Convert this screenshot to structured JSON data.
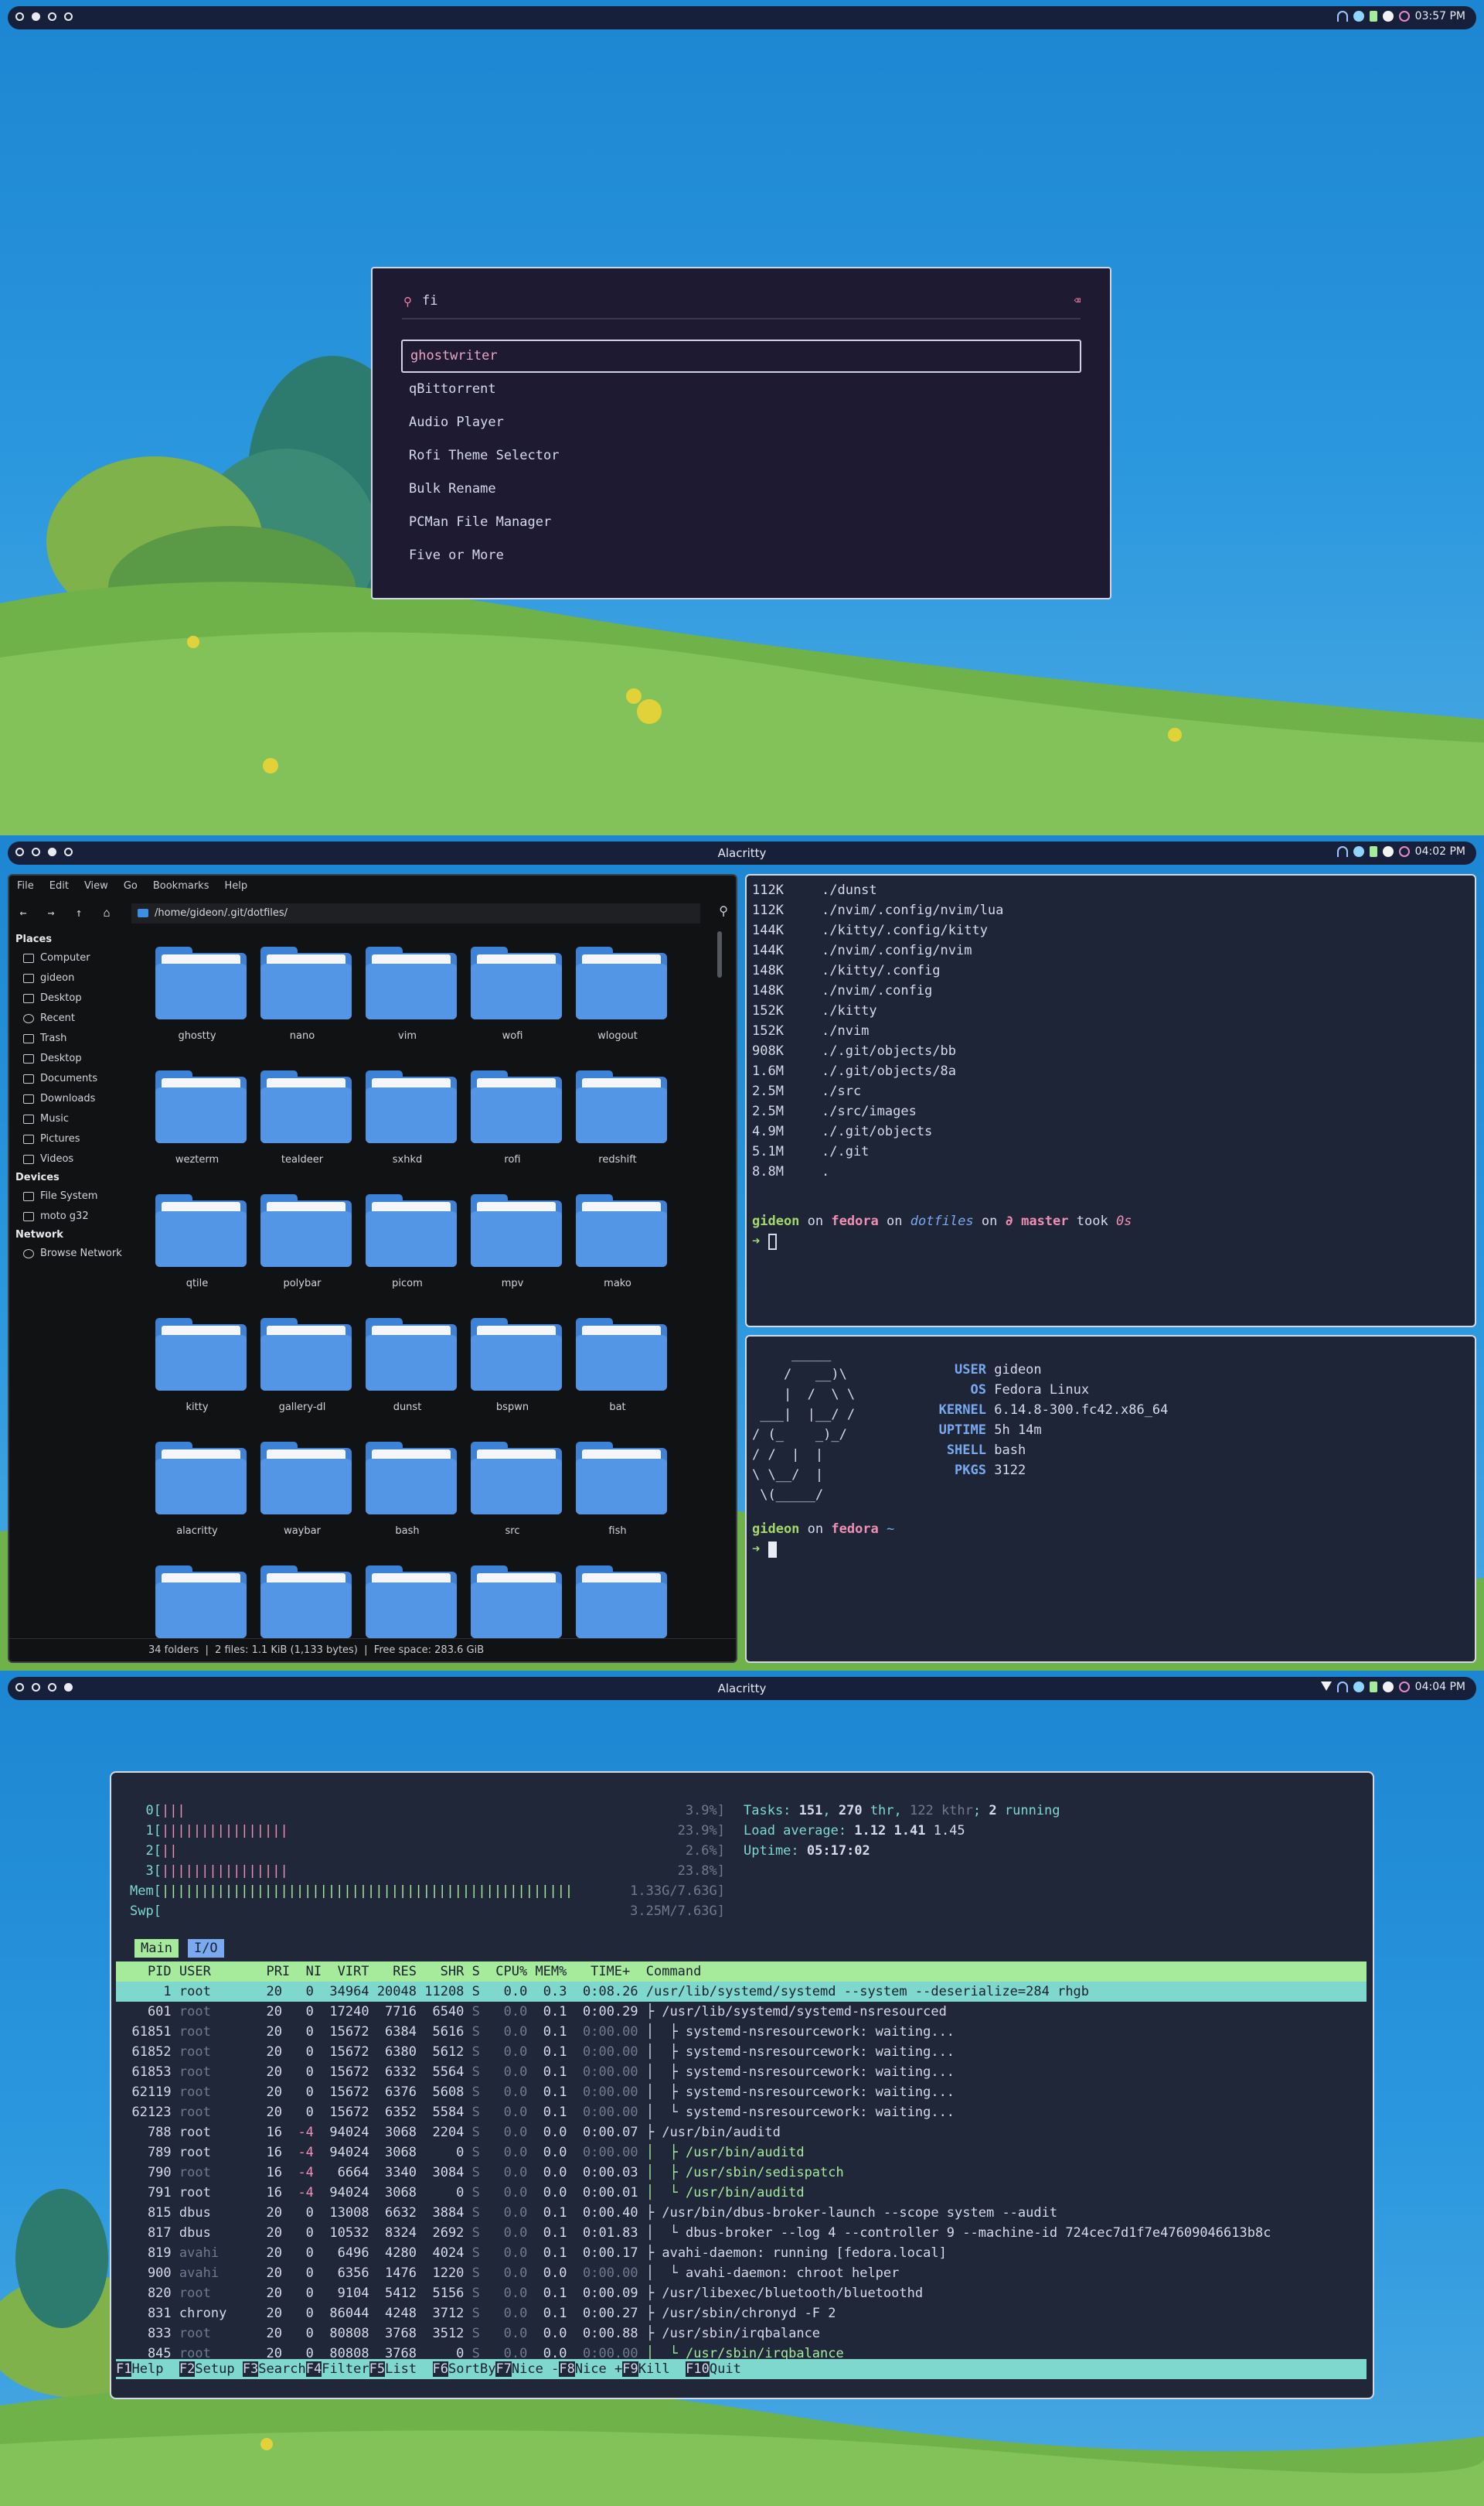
{
  "screen1": {
    "workspaces": [
      false,
      true,
      false,
      false
    ],
    "clock": "03:57 PM",
    "rofi": {
      "query": "fi",
      "items": [
        "ghostwriter",
        "qBittorrent",
        "Audio Player",
        "Rofi Theme Selector",
        "Bulk Rename",
        "PCMan File Manager",
        "Five or More"
      ],
      "selected": 0
    }
  },
  "screen2": {
    "title": "Alacritty",
    "clock": "04:02 PM",
    "filemanager": {
      "menu": [
        "File",
        "Edit",
        "View",
        "Go",
        "Bookmarks",
        "Help"
      ],
      "path": "/home/gideon/.git/dotfiles/",
      "places_header": "Places",
      "places": [
        "Computer",
        "gideon",
        "Desktop",
        "Recent",
        "Trash",
        "Desktop",
        "Documents",
        "Downloads",
        "Music",
        "Pictures",
        "Videos"
      ],
      "devices_header": "Devices",
      "devices": [
        "File System",
        "moto g32"
      ],
      "network_header": "Network",
      "network": [
        "Browse Network"
      ],
      "folders": [
        "ghostty",
        "nano",
        "vim",
        "wofi",
        "wlogout",
        "wezterm",
        "tealdeer",
        "sxhkd",
        "rofi",
        "redshift",
        "qtile",
        "polybar",
        "picom",
        "mpv",
        "mako",
        "kitty",
        "gallery-dl",
        "dunst",
        "bspwn",
        "bat",
        "alacritty",
        "waybar",
        "bash",
        "src",
        "fish",
        "",
        "",
        "",
        "",
        ""
      ],
      "status": "34 folders  |  2 files: 1.1 KiB (1,133 bytes)  |  Free space: 283.6 GiB"
    },
    "du": [
      [
        "112K",
        "./dunst"
      ],
      [
        "112K",
        "./nvim/.config/nvim/lua"
      ],
      [
        "144K",
        "./kitty/.config/kitty"
      ],
      [
        "144K",
        "./nvim/.config/nvim"
      ],
      [
        "148K",
        "./kitty/.config"
      ],
      [
        "148K",
        "./nvim/.config"
      ],
      [
        "152K",
        "./kitty"
      ],
      [
        "152K",
        "./nvim"
      ],
      [
        "908K",
        "./.git/objects/bb"
      ],
      [
        "1.6M",
        "./.git/objects/8a"
      ],
      [
        "2.5M",
        "./src"
      ],
      [
        "2.5M",
        "./src/images"
      ],
      [
        "4.9M",
        "./.git/objects"
      ],
      [
        "5.1M",
        "./.git"
      ],
      [
        "8.8M",
        "."
      ]
    ],
    "prompt1": {
      "user": "gideon",
      "on1": " on ",
      "host": "fedora",
      "dir": "dotfiles",
      "on2": " on ",
      "branch_icon": "∂",
      "branch": "master",
      "took": " took ",
      "time": "0s"
    },
    "arrow": "➜",
    "fetch": {
      "art": [
        "     _____",
        "    /   __)\\",
        "    |  /  \\ \\",
        " ___|  |__/ /",
        "/ (_    _)_/",
        "/ /  |  |",
        "\\ \\__/  |",
        " \\(_____/"
      ],
      "labels": [
        "USER",
        "OS",
        "KERNEL",
        "UPTIME",
        "SHELL",
        "PKGS"
      ],
      "values": [
        "gideon",
        "Fedora Linux",
        "6.14.8-300.fc42.x86_64",
        "5h 14m",
        "bash",
        "3122"
      ]
    },
    "prompt2": {
      "user": "gideon",
      "on": " on ",
      "host": "fedora",
      "dir": "~"
    }
  },
  "screen3": {
    "title": "Alacritty",
    "clock": "04:04 PM",
    "cpu": [
      {
        "label": "0",
        "bars": "|||",
        "value": "3.9%"
      },
      {
        "label": "1",
        "bars": "||||||||||||||||",
        "value": "23.9%"
      },
      {
        "label": "2",
        "bars": "||",
        "value": "2.6%"
      },
      {
        "label": "3",
        "bars": "||||||||||||||||",
        "value": "23.8%"
      }
    ],
    "mem": {
      "label": "Mem",
      "bars": "||||||||||||||||||||||||||||||||||||||||||||||||||||",
      "value": "1.33G/7.63G"
    },
    "swp": {
      "label": "Swp",
      "bars": "",
      "value": "3.25M/7.63G"
    },
    "tasks": {
      "prefix": "Tasks: ",
      "count": "151",
      "sep": ", ",
      "thr": "270",
      "thr_label": " thr, ",
      "kthr": "122 kthr",
      "sep2": "; ",
      "running": "2",
      "running_label": " running"
    },
    "load": {
      "prefix": "Load average: ",
      "v1": "1.12",
      "v2": "1.41",
      "v3": "1.45"
    },
    "uptime": {
      "prefix": "Uptime: ",
      "value": "05:17:02"
    },
    "tabs": [
      "Main",
      "I/O"
    ],
    "header": "    PID USER       PRI  NI  VIRT   RES   SHR S  CPU% MEM%   TIME+  Command",
    "rows": [
      [
        "1",
        "root",
        "20",
        "0",
        "34964",
        "20048",
        "11208",
        "S",
        "0.0",
        "0.3",
        "0:08.26",
        "/usr/lib/systemd/systemd --system --deserialize=284 rhgb"
      ],
      [
        "601",
        "root",
        "20",
        "0",
        "17240",
        "7716",
        "6540",
        "S",
        "0.0",
        "0.1",
        "0:00.29",
        "├ /usr/lib/systemd/systemd-nsresourced"
      ],
      [
        "61851",
        "root",
        "20",
        "0",
        "15672",
        "6384",
        "5616",
        "S",
        "0.0",
        "0.1",
        "0:00.00",
        "│  ├ systemd-nsresourcework: waiting..."
      ],
      [
        "61852",
        "root",
        "20",
        "0",
        "15672",
        "6380",
        "5612",
        "S",
        "0.0",
        "0.1",
        "0:00.00",
        "│  ├ systemd-nsresourcework: waiting..."
      ],
      [
        "61853",
        "root",
        "20",
        "0",
        "15672",
        "6332",
        "5564",
        "S",
        "0.0",
        "0.1",
        "0:00.00",
        "│  ├ systemd-nsresourcework: waiting..."
      ],
      [
        "62119",
        "root",
        "20",
        "0",
        "15672",
        "6376",
        "5608",
        "S",
        "0.0",
        "0.1",
        "0:00.00",
        "│  ├ systemd-nsresourcework: waiting..."
      ],
      [
        "62123",
        "root",
        "20",
        "0",
        "15672",
        "6352",
        "5584",
        "S",
        "0.0",
        "0.1",
        "0:00.00",
        "│  └ systemd-nsresourcework: waiting..."
      ],
      [
        "788",
        "root",
        "16",
        "-4",
        "94024",
        "3068",
        "2204",
        "S",
        "0.0",
        "0.0",
        "0:00.07",
        "├ /usr/bin/auditd"
      ],
      [
        "789",
        "root",
        "16",
        "-4",
        "94024",
        "3068",
        "0",
        "S",
        "0.0",
        "0.0",
        "0:00.00",
        "│  ├ /usr/bin/auditd"
      ],
      [
        "790",
        "root",
        "16",
        "-4",
        "6664",
        "3340",
        "3084",
        "S",
        "0.0",
        "0.0",
        "0:00.03",
        "│  ├ /usr/sbin/sedispatch"
      ],
      [
        "791",
        "root",
        "16",
        "-4",
        "94024",
        "3068",
        "0",
        "S",
        "0.0",
        "0.0",
        "0:00.01",
        "│  └ /usr/bin/auditd"
      ],
      [
        "815",
        "dbus",
        "20",
        "0",
        "13008",
        "6632",
        "3884",
        "S",
        "0.0",
        "0.1",
        "0:00.40",
        "├ /usr/bin/dbus-broker-launch --scope system --audit"
      ],
      [
        "817",
        "dbus",
        "20",
        "0",
        "10532",
        "8324",
        "2692",
        "S",
        "0.0",
        "0.1",
        "0:01.83",
        "│  └ dbus-broker --log 4 --controller 9 --machine-id 724cec7d1f7e47609046613b8c"
      ],
      [
        "819",
        "avahi",
        "20",
        "0",
        "6496",
        "4280",
        "4024",
        "S",
        "0.0",
        "0.1",
        "0:00.17",
        "├ avahi-daemon: running [fedora.local]"
      ],
      [
        "900",
        "avahi",
        "20",
        "0",
        "6356",
        "1476",
        "1220",
        "S",
        "0.0",
        "0.0",
        "0:00.00",
        "│  └ avahi-daemon: chroot helper"
      ],
      [
        "820",
        "root",
        "20",
        "0",
        "9104",
        "5412",
        "5156",
        "S",
        "0.0",
        "0.1",
        "0:00.09",
        "├ /usr/libexec/bluetooth/bluetoothd"
      ],
      [
        "831",
        "chrony",
        "20",
        "0",
        "86044",
        "4248",
        "3712",
        "S",
        "0.0",
        "0.1",
        "0:00.27",
        "├ /usr/sbin/chronyd -F 2"
      ],
      [
        "833",
        "root",
        "20",
        "0",
        "80808",
        "3768",
        "3512",
        "S",
        "0.0",
        "0.0",
        "0:00.88",
        "├ /usr/sbin/irqbalance"
      ],
      [
        "845",
        "root",
        "20",
        "0",
        "80808",
        "3768",
        "0",
        "S",
        "0.0",
        "0.0",
        "0:00.00",
        "│  └ /usr/sbin/irqbalance"
      ]
    ],
    "footer": [
      [
        "F1",
        "Help  "
      ],
      [
        "F2",
        "Setup "
      ],
      [
        "F3",
        "Search"
      ],
      [
        "F4",
        "Filter"
      ],
      [
        "F5",
        "List  "
      ],
      [
        "F6",
        "SortBy"
      ],
      [
        "F7",
        "Nice -"
      ],
      [
        "F8",
        "Nice +"
      ],
      [
        "F9",
        "Kill  "
      ],
      [
        "F10",
        "Quit  "
      ]
    ]
  },
  "colors": {
    "bar": "#16203a",
    "rofi_bg": "#1d1a31",
    "accent_pink": "#f08fb5",
    "term_bg": "#1e2536",
    "htop_green": "#a6ea9c",
    "htop_cyan": "#7ed8cd"
  }
}
